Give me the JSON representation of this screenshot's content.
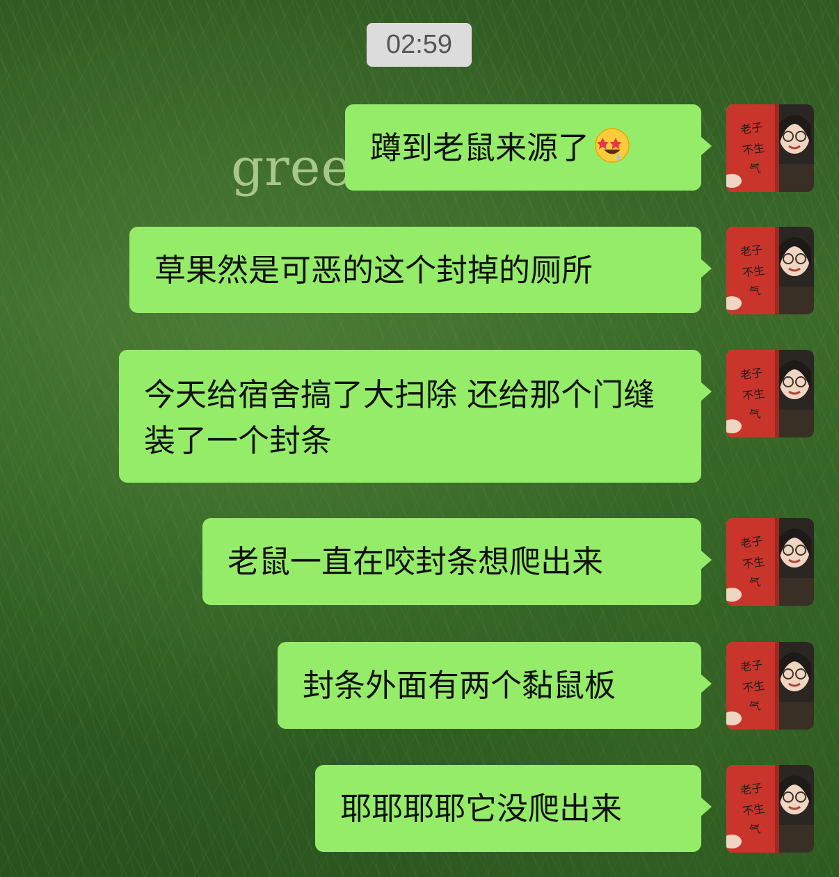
{
  "status": {
    "timestamp": "02:59"
  },
  "wallpaper": {
    "text": "gree"
  },
  "messages": [
    {
      "text": "蹲到老鼠来源了",
      "emoji": "star-struck-emoji"
    },
    {
      "text": "草果然是可恶的这个封掉的厕所"
    },
    {
      "text": "今天给宿舍搞了大扫除 还给那个门缝装了一个封条"
    },
    {
      "text": "老鼠一直在咬封条想爬出来"
    },
    {
      "text": "封条外面有两个黏鼠板"
    },
    {
      "text": "耶耶耶耶它没爬出来"
    }
  ],
  "avatar": {
    "book_title": "老子不生气",
    "icon": "user-avatar-icon"
  },
  "colors": {
    "bubble": "#95ec69",
    "timestamp_bg": "#dcdcdc",
    "wallpaper": "#2f5a22"
  }
}
